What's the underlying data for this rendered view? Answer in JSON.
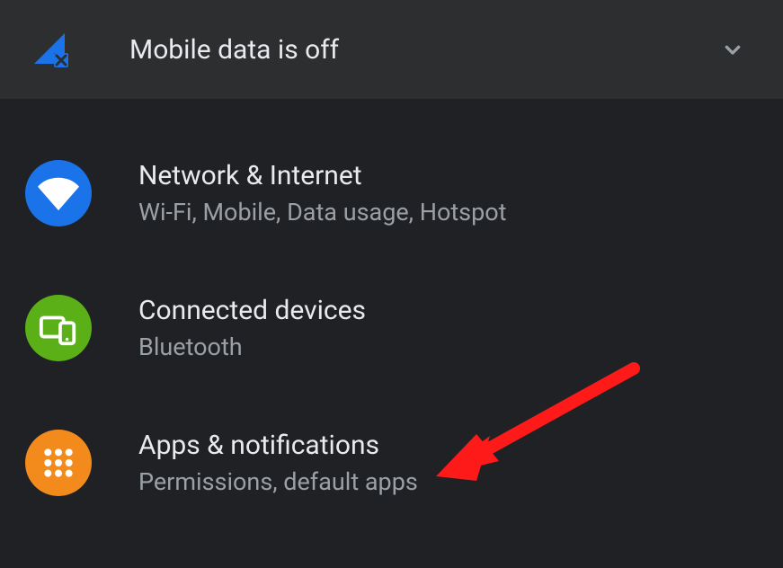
{
  "header": {
    "title": "Mobile data is off"
  },
  "items": [
    {
      "title": "Network & Internet",
      "subtitle": "Wi-Fi, Mobile, Data usage, Hotspot",
      "icon": "wifi-icon",
      "color": "#1a73e8"
    },
    {
      "title": "Connected devices",
      "subtitle": "Bluetooth",
      "icon": "devices-icon",
      "color": "#5bb017"
    },
    {
      "title": "Apps & notifications",
      "subtitle": "Permissions, default apps",
      "icon": "apps-icon",
      "color": "#f28b1c"
    }
  ]
}
